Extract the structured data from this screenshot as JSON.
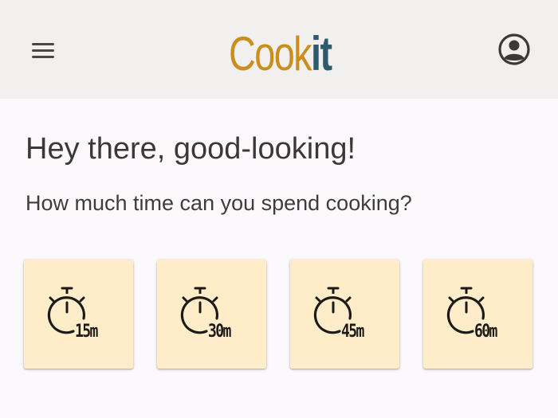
{
  "header": {
    "logo_part1": "Cook",
    "logo_part2": "it",
    "icons": {
      "menu": "hamburger-icon",
      "account": "account-circle-icon"
    },
    "colors": {
      "logo_primary": "#c98e1c",
      "logo_secondary": "#2e5a6e",
      "bar_background": "#f2f0ef"
    }
  },
  "main": {
    "greeting": "Hey there, good-looking!",
    "prompt": "How much time can you spend cooking?",
    "time_options": [
      {
        "label": "15m",
        "icon": "stopwatch-icon"
      },
      {
        "label": "30m",
        "icon": "stopwatch-icon"
      },
      {
        "label": "45m",
        "icon": "stopwatch-icon"
      },
      {
        "label": "60m",
        "icon": "stopwatch-icon"
      }
    ],
    "colors": {
      "card_background": "#ffedc9"
    }
  }
}
